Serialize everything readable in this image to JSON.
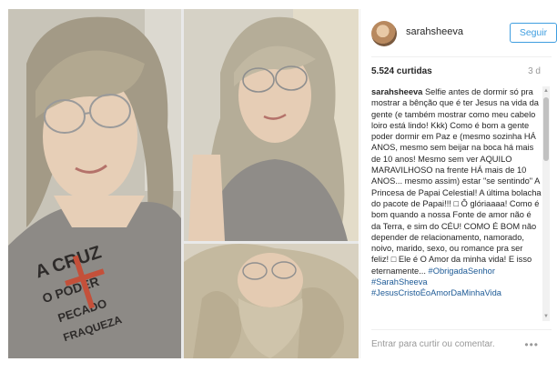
{
  "post": {
    "username": "sarahsheeva",
    "follow_label": "Seguir",
    "likes": "5.524 curtidas",
    "time": "3 d",
    "caption_user": "sarahsheeva",
    "caption_text": "Selfie antes de dormir só pra mostrar a bênção que é ter Jesus na vida da gente (e também mostrar como meu cabelo loiro está lindo! Kkk) Como é bom a gente poder dormir em Paz e (mesmo sozinha HÁ ANOS, mesmo sem beijar na boca há mais de 10 anos! Mesmo sem ver AQUILO MARAVILHOSO na frente HÁ mais de 10 ANOS... mesmo assim) estar \"se sentindo\" A Princesa de Papai Celestial! A última bolacha do pacote de Papai!!! □ Ô glóriaaaa! Como é bom quando a nossa Fonte de amor não é da Terra, e sim do CÉU! COMO É BOM não depender de relacionamento, namorado, noivo, marido, sexo, ou romance pra ser feliz! □ Ele é O Amor da minha vida! E isso eternamente... ",
    "hashtags": [
      "#ObrigadaSenhor",
      "#SarahSheeva",
      "#JesusCristoÉoAmorDaMinhaVida"
    ],
    "comment_placeholder": "Entrar para curtir ou comentar.",
    "more_label": "•••"
  },
  "photo_text": {
    "shirt_line1": "A CRUZ",
    "shirt_line2": "O PODER",
    "shirt_line3": "PECADO",
    "shirt_line4": "FRAQUEZA"
  }
}
